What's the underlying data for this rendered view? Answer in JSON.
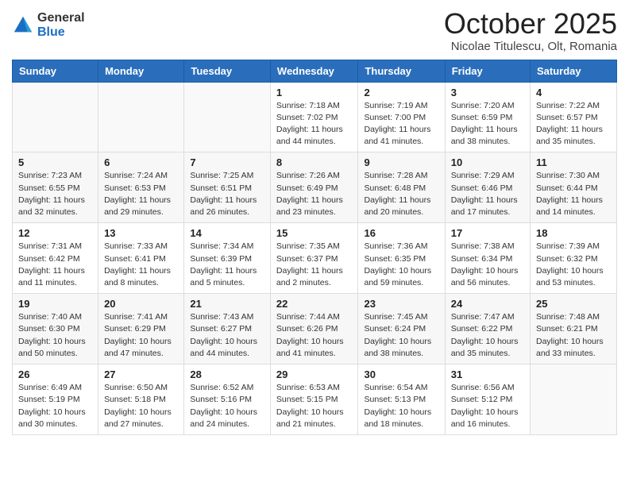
{
  "header": {
    "logo_general": "General",
    "logo_blue": "Blue",
    "month_title": "October 2025",
    "subtitle": "Nicolae Titulescu, Olt, Romania"
  },
  "days_of_week": [
    "Sunday",
    "Monday",
    "Tuesday",
    "Wednesday",
    "Thursday",
    "Friday",
    "Saturday"
  ],
  "weeks": [
    [
      {
        "day": "",
        "info": ""
      },
      {
        "day": "",
        "info": ""
      },
      {
        "day": "",
        "info": ""
      },
      {
        "day": "1",
        "info": "Sunrise: 7:18 AM\nSunset: 7:02 PM\nDaylight: 11 hours and 44 minutes."
      },
      {
        "day": "2",
        "info": "Sunrise: 7:19 AM\nSunset: 7:00 PM\nDaylight: 11 hours and 41 minutes."
      },
      {
        "day": "3",
        "info": "Sunrise: 7:20 AM\nSunset: 6:59 PM\nDaylight: 11 hours and 38 minutes."
      },
      {
        "day": "4",
        "info": "Sunrise: 7:22 AM\nSunset: 6:57 PM\nDaylight: 11 hours and 35 minutes."
      }
    ],
    [
      {
        "day": "5",
        "info": "Sunrise: 7:23 AM\nSunset: 6:55 PM\nDaylight: 11 hours and 32 minutes."
      },
      {
        "day": "6",
        "info": "Sunrise: 7:24 AM\nSunset: 6:53 PM\nDaylight: 11 hours and 29 minutes."
      },
      {
        "day": "7",
        "info": "Sunrise: 7:25 AM\nSunset: 6:51 PM\nDaylight: 11 hours and 26 minutes."
      },
      {
        "day": "8",
        "info": "Sunrise: 7:26 AM\nSunset: 6:49 PM\nDaylight: 11 hours and 23 minutes."
      },
      {
        "day": "9",
        "info": "Sunrise: 7:28 AM\nSunset: 6:48 PM\nDaylight: 11 hours and 20 minutes."
      },
      {
        "day": "10",
        "info": "Sunrise: 7:29 AM\nSunset: 6:46 PM\nDaylight: 11 hours and 17 minutes."
      },
      {
        "day": "11",
        "info": "Sunrise: 7:30 AM\nSunset: 6:44 PM\nDaylight: 11 hours and 14 minutes."
      }
    ],
    [
      {
        "day": "12",
        "info": "Sunrise: 7:31 AM\nSunset: 6:42 PM\nDaylight: 11 hours and 11 minutes."
      },
      {
        "day": "13",
        "info": "Sunrise: 7:33 AM\nSunset: 6:41 PM\nDaylight: 11 hours and 8 minutes."
      },
      {
        "day": "14",
        "info": "Sunrise: 7:34 AM\nSunset: 6:39 PM\nDaylight: 11 hours and 5 minutes."
      },
      {
        "day": "15",
        "info": "Sunrise: 7:35 AM\nSunset: 6:37 PM\nDaylight: 11 hours and 2 minutes."
      },
      {
        "day": "16",
        "info": "Sunrise: 7:36 AM\nSunset: 6:35 PM\nDaylight: 10 hours and 59 minutes."
      },
      {
        "day": "17",
        "info": "Sunrise: 7:38 AM\nSunset: 6:34 PM\nDaylight: 10 hours and 56 minutes."
      },
      {
        "day": "18",
        "info": "Sunrise: 7:39 AM\nSunset: 6:32 PM\nDaylight: 10 hours and 53 minutes."
      }
    ],
    [
      {
        "day": "19",
        "info": "Sunrise: 7:40 AM\nSunset: 6:30 PM\nDaylight: 10 hours and 50 minutes."
      },
      {
        "day": "20",
        "info": "Sunrise: 7:41 AM\nSunset: 6:29 PM\nDaylight: 10 hours and 47 minutes."
      },
      {
        "day": "21",
        "info": "Sunrise: 7:43 AM\nSunset: 6:27 PM\nDaylight: 10 hours and 44 minutes."
      },
      {
        "day": "22",
        "info": "Sunrise: 7:44 AM\nSunset: 6:26 PM\nDaylight: 10 hours and 41 minutes."
      },
      {
        "day": "23",
        "info": "Sunrise: 7:45 AM\nSunset: 6:24 PM\nDaylight: 10 hours and 38 minutes."
      },
      {
        "day": "24",
        "info": "Sunrise: 7:47 AM\nSunset: 6:22 PM\nDaylight: 10 hours and 35 minutes."
      },
      {
        "day": "25",
        "info": "Sunrise: 7:48 AM\nSunset: 6:21 PM\nDaylight: 10 hours and 33 minutes."
      }
    ],
    [
      {
        "day": "26",
        "info": "Sunrise: 6:49 AM\nSunset: 5:19 PM\nDaylight: 10 hours and 30 minutes."
      },
      {
        "day": "27",
        "info": "Sunrise: 6:50 AM\nSunset: 5:18 PM\nDaylight: 10 hours and 27 minutes."
      },
      {
        "day": "28",
        "info": "Sunrise: 6:52 AM\nSunset: 5:16 PM\nDaylight: 10 hours and 24 minutes."
      },
      {
        "day": "29",
        "info": "Sunrise: 6:53 AM\nSunset: 5:15 PM\nDaylight: 10 hours and 21 minutes."
      },
      {
        "day": "30",
        "info": "Sunrise: 6:54 AM\nSunset: 5:13 PM\nDaylight: 10 hours and 18 minutes."
      },
      {
        "day": "31",
        "info": "Sunrise: 6:56 AM\nSunset: 5:12 PM\nDaylight: 10 hours and 16 minutes."
      },
      {
        "day": "",
        "info": ""
      }
    ]
  ]
}
